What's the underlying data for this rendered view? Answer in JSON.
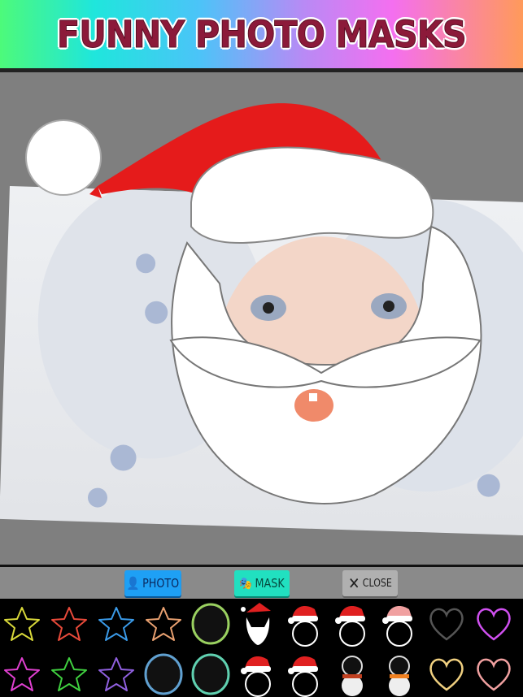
{
  "banner": {
    "title": "FUNNY PHOTO MASKS"
  },
  "editor": {
    "mask": "santa-hat-beard-mask",
    "photo": "baby-photo"
  },
  "toolbar": {
    "photo": {
      "label": "PHOTO",
      "icon": "person-icon",
      "color": "#1ea0f5"
    },
    "mask": {
      "label": "MASK",
      "icon": "theater-masks-icon",
      "color": "#21e0c0"
    },
    "close": {
      "label": "CLOSE",
      "icon": "x-icon",
      "color": "#b0b0b0"
    }
  },
  "masks": {
    "row1": [
      {
        "name": "star-yellow",
        "color": "#d8d83a"
      },
      {
        "name": "star-red",
        "color": "#e84a3a"
      },
      {
        "name": "star-blue",
        "color": "#3a9ae8"
      },
      {
        "name": "star-multicolor",
        "color": "#e8a070"
      },
      {
        "name": "bubble",
        "color": "#9ad060"
      },
      {
        "name": "santa-beard",
        "color": "#e02020"
      },
      {
        "name": "santa-hat-circle",
        "color": "#e02020"
      },
      {
        "name": "santa-hat-circle",
        "color": "#e02020"
      },
      {
        "name": "reindeer-snowman",
        "color": "#f0a0a0"
      },
      {
        "name": "heart-gray",
        "color": "#555555"
      },
      {
        "name": "heart-rainbow",
        "color": "#d050f0"
      }
    ],
    "row2": [
      {
        "name": "star-pink",
        "color": "#e040d0"
      },
      {
        "name": "star-green",
        "color": "#40d040"
      },
      {
        "name": "star-glitter",
        "color": "#9060e0"
      },
      {
        "name": "bubble",
        "color": "#60a0d0"
      },
      {
        "name": "bubble",
        "color": "#60d0b0"
      },
      {
        "name": "santa-hat-circle",
        "color": "#e02020"
      },
      {
        "name": "santa-hat-circle",
        "color": "#e02020"
      },
      {
        "name": "snowman-scarf",
        "color": "#c04020"
      },
      {
        "name": "snowman-circle",
        "color": "#f08020"
      },
      {
        "name": "heart-gold",
        "color": "#f0d080"
      },
      {
        "name": "heart-pink",
        "color": "#f0a0a0"
      }
    ]
  }
}
